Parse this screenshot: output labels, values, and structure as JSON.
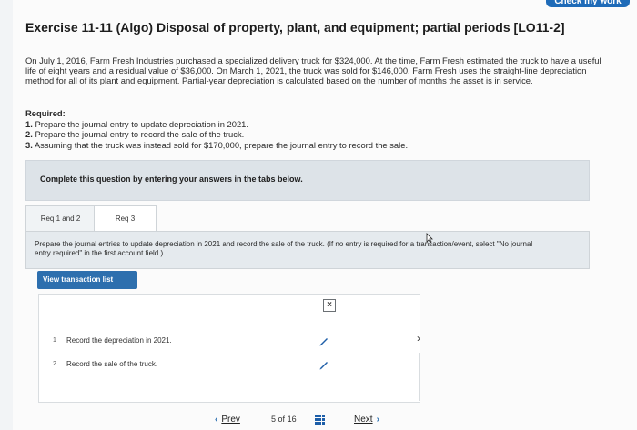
{
  "header": {
    "check_label": "Check my work"
  },
  "exercise": {
    "title": "Exercise 11-11 (Algo) Disposal of property, plant, and equipment; partial periods [LO11-2]",
    "intro": "On July 1, 2016, Farm Fresh Industries purchased a specialized delivery truck for $324,000. At the time, Farm Fresh estimated the truck to have a useful life of eight years and a residual value of $36,000. On March 1, 2021, the truck was sold for $146,000. Farm Fresh uses the straight-line depreciation method for all of its plant and equipment. Partial-year depreciation is calculated based on the number of months the asset is in service.",
    "required_head": "Required:",
    "requirements": [
      {
        "num": "1.",
        "text": "Prepare the journal entry to update depreciation in 2021."
      },
      {
        "num": "2.",
        "text": "Prepare the journal entry to record the sale of the truck."
      },
      {
        "num": "3.",
        "text": "Assuming that the truck was instead sold for $170,000, prepare the journal entry to record the sale."
      }
    ]
  },
  "panel": {
    "text": "Complete this question by entering your answers in the tabs below."
  },
  "tabs": [
    {
      "label": "Req 1 and 2"
    },
    {
      "label": "Req 3"
    }
  ],
  "instruction": "Prepare the journal entries to update depreciation in 2021 and record the sale of the truck. (If no entry is required for a transaction/event, select \"No journal entry required\" in the first account field.)",
  "view_button": "View transaction list",
  "transactions": [
    {
      "num": "1",
      "text": "Record the depreciation in 2021."
    },
    {
      "num": "2",
      "text": "Record the sale of the truck."
    }
  ],
  "footer": {
    "prev": "Prev",
    "page_current": "5",
    "page_of": "of",
    "page_total": "16",
    "next": "Next"
  },
  "colors": {
    "accent": "#2d6fae",
    "panel": "#dde3e8"
  }
}
